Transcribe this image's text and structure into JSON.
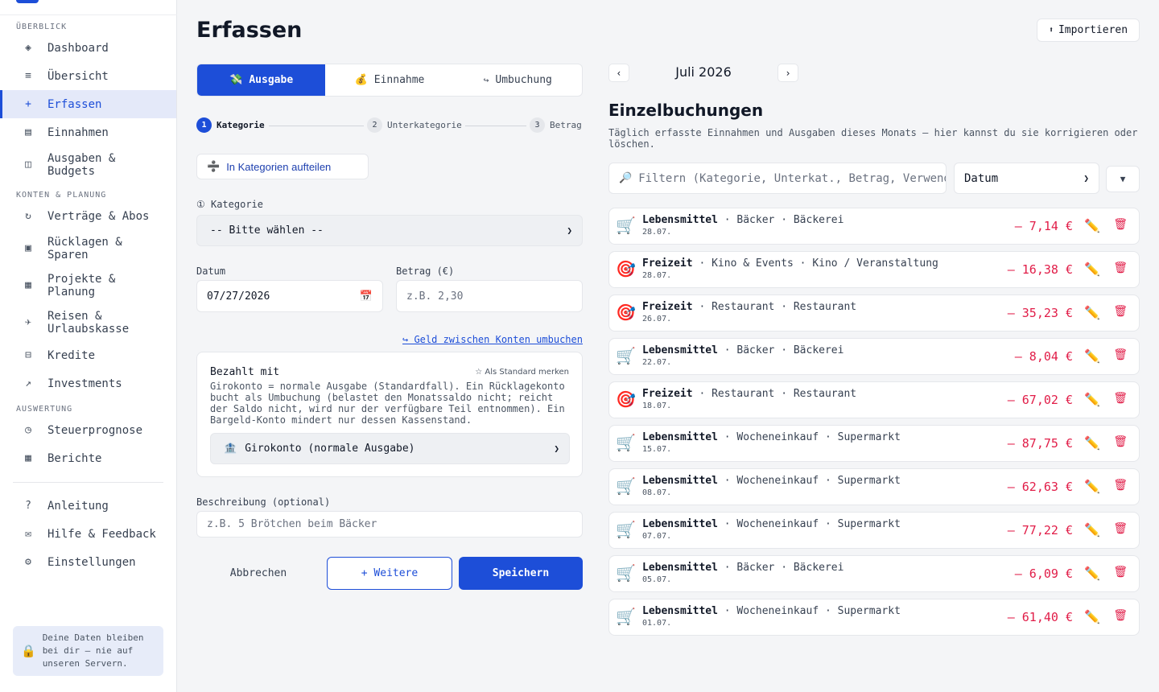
{
  "sidebar": {
    "sections": [
      "ÜBERBLICK",
      "KONTEN & PLANUNG",
      "AUSWERTUNG"
    ],
    "items": [
      {
        "label": "Dashboard",
        "icon": "◈"
      },
      {
        "label": "Übersicht",
        "icon": "≡"
      },
      {
        "label": "Erfassen",
        "icon": "+"
      },
      {
        "label": "Einnahmen",
        "icon": "▤"
      },
      {
        "label": "Ausgaben & Budgets",
        "icon": "◫"
      },
      {
        "label": "Verträge & Abos",
        "icon": "↻"
      },
      {
        "label": "Rücklagen & Sparen",
        "icon": "▣"
      },
      {
        "label": "Projekte & Planung",
        "icon": "▦"
      },
      {
        "label": "Reisen & Urlaubskasse",
        "icon": "✈"
      },
      {
        "label": "Kredite",
        "icon": "⊟"
      },
      {
        "label": "Investments",
        "icon": "↗"
      },
      {
        "label": "Steuerprognose",
        "icon": "◷"
      },
      {
        "label": "Berichte",
        "icon": "▦"
      },
      {
        "label": "Anleitung",
        "icon": "?"
      },
      {
        "label": "Hilfe & Feedback",
        "icon": "✉"
      },
      {
        "label": "Einstellungen",
        "icon": "⚙"
      }
    ],
    "active_item": "Erfassen",
    "privacy_note": "Deine Daten bleiben bei dir — nie auf unseren Servern."
  },
  "header": {
    "title": "Erfassen",
    "import_label": "Importieren",
    "import_icon": "⬆"
  },
  "form": {
    "type_tabs": [
      {
        "label": "Ausgabe",
        "icon": "💸"
      },
      {
        "label": "Einnahme",
        "icon": "💰"
      },
      {
        "label": "Umbuchung",
        "icon": "↪"
      }
    ],
    "active_type": "Ausgabe",
    "steps": [
      {
        "number": "1",
        "label": "Kategorie"
      },
      {
        "number": "2",
        "label": "Unterkategorie"
      },
      {
        "number": "3",
        "label": "Betrag"
      }
    ],
    "active_step": 1,
    "split_label": "In Kategorien aufteilen",
    "category_label": "① Kategorie",
    "category_value": "-- Bitte wählen --",
    "date_label": "Datum",
    "date_value": "07/27/2026",
    "amount_label": "Betrag (€)",
    "amount_placeholder": "z.B. 2,30",
    "transfer_link": "↪ Geld zwischen Konten umbuchen",
    "paid_with": {
      "title": "Bezahlt mit",
      "set_default": "☆ Als Standard merken",
      "description": "Girokonto = normale Ausgabe (Standardfall). Ein Rücklagekonto bucht als Umbuchung (belastet den Monatssaldo nicht; reicht der Saldo nicht, wird nur der verfügbare Teil entnommen). Ein Bargeld-Konto mindert nur dessen Kassenstand.",
      "account_value": "Girokonto (normale Ausgabe)",
      "account_icon": "🏦"
    },
    "description_label": "Beschreibung (optional)",
    "description_placeholder": "z.B. 5 Brötchen beim Bäcker",
    "cancel_label": "Abbrechen",
    "more_label": "+ Weitere",
    "save_label": "Speichern"
  },
  "bookings": {
    "prev": "‹",
    "next": "›",
    "month": "Juli 2026",
    "title": "Einzelbuchungen",
    "subtitle": "Täglich erfasste Einnahmen und Ausgaben dieses Monats — hier kannst du sie korrigieren oder löschen.",
    "filter_placeholder": "Filtern (Kategorie, Unterkat., Betrag, Verwendungszweck)",
    "sort_value": "Datum",
    "sort_dir": "▼",
    "rows": [
      {
        "icon": "🛒",
        "category": "Lebensmittel",
        "path": " · Bäcker · Bäckerei",
        "date": "28.07.",
        "amount": "– 7,14 €"
      },
      {
        "icon": "🎯",
        "category": "Freizeit",
        "path": " · Kino & Events · Kino / Veranstaltung",
        "date": "28.07.",
        "amount": "– 16,38 €"
      },
      {
        "icon": "🎯",
        "category": "Freizeit",
        "path": " · Restaurant · Restaurant",
        "date": "26.07.",
        "amount": "– 35,23 €"
      },
      {
        "icon": "🛒",
        "category": "Lebensmittel",
        "path": " · Bäcker · Bäckerei",
        "date": "22.07.",
        "amount": "– 8,04 €"
      },
      {
        "icon": "🎯",
        "category": "Freizeit",
        "path": " · Restaurant · Restaurant",
        "date": "18.07.",
        "amount": "– 67,02 €"
      },
      {
        "icon": "🛒",
        "category": "Lebensmittel",
        "path": " · Wocheneinkauf · Supermarkt",
        "date": "15.07.",
        "amount": "– 87,75 €"
      },
      {
        "icon": "🛒",
        "category": "Lebensmittel",
        "path": " · Wocheneinkauf · Supermarkt",
        "date": "08.07.",
        "amount": "– 62,63 €"
      },
      {
        "icon": "🛒",
        "category": "Lebensmittel",
        "path": " · Wocheneinkauf · Supermarkt",
        "date": "07.07.",
        "amount": "– 77,22 €"
      },
      {
        "icon": "🛒",
        "category": "Lebensmittel",
        "path": " · Bäcker · Bäckerei",
        "date": "05.07.",
        "amount": "– 6,09 €"
      },
      {
        "icon": "🛒",
        "category": "Lebensmittel",
        "path": " · Wocheneinkauf · Supermarkt",
        "date": "01.07.",
        "amount": "– 61,40 €"
      }
    ],
    "edit_icon": "✏️",
    "delete_icon": "🗑"
  },
  "colors": {
    "accent": "#1d4ed8",
    "negative": "#e11d48",
    "active_bg": "#e4e9f9"
  }
}
